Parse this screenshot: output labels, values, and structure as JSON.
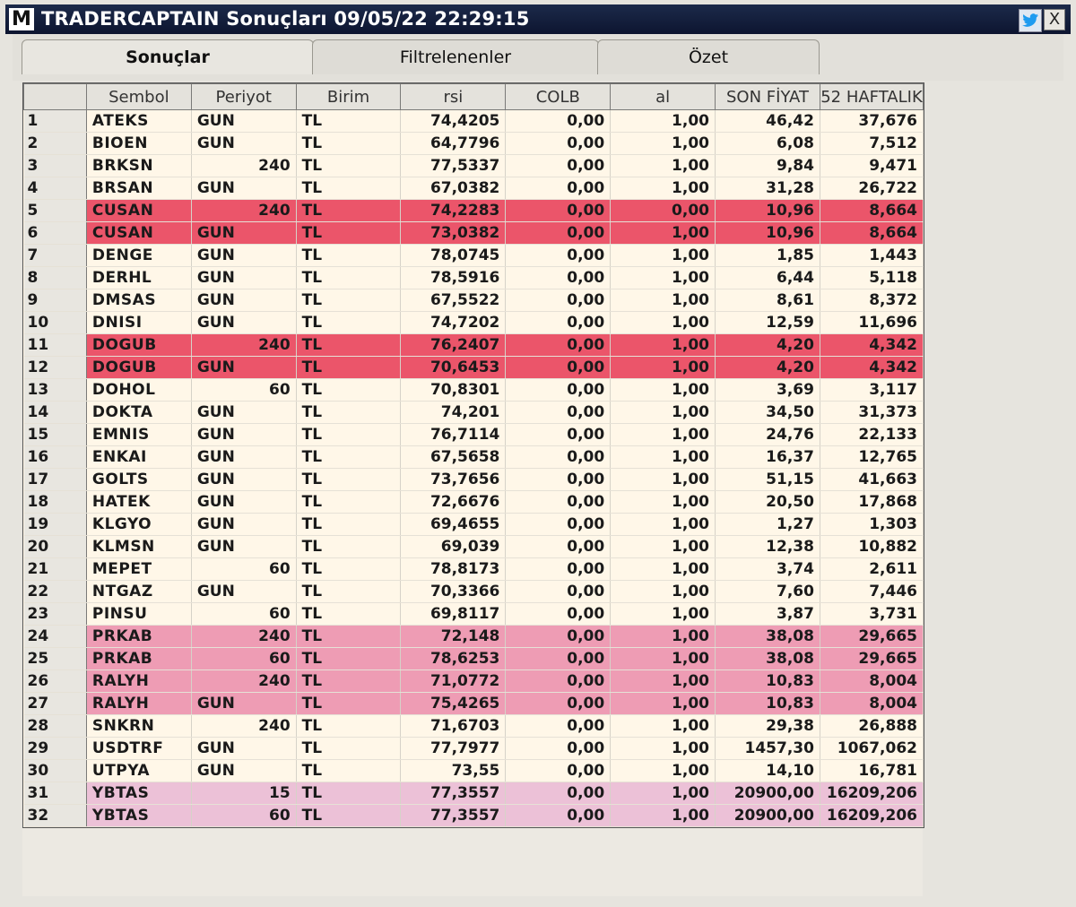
{
  "window": {
    "icon_letter": "M",
    "title": "TRADERCAPTAIN Sonuçları  09/05/22 22:29:15",
    "close_label": "X"
  },
  "tabs": [
    "Sonuçlar",
    "Filtrelenenler",
    "Özet"
  ],
  "columns": [
    "Sembol",
    "Periyot",
    "Birim",
    "rsi",
    "COLB",
    "al",
    "SON FİYAT",
    "52 HAFTALIK"
  ],
  "rows": [
    {
      "no": "1",
      "sym": "ATEKS",
      "per": "GUN",
      "unit": "TL",
      "rsi": "74,4205",
      "colb": "0,00",
      "al": "1,00",
      "price": "46,42",
      "w52": "37,676",
      "hl": ""
    },
    {
      "no": "2",
      "sym": "BIOEN",
      "per": "GUN",
      "unit": "TL",
      "rsi": "64,7796",
      "colb": "0,00",
      "al": "1,00",
      "price": "6,08",
      "w52": "7,512",
      "hl": ""
    },
    {
      "no": "3",
      "sym": "BRKSN",
      "per": "240",
      "unit": "TL",
      "rsi": "77,5337",
      "colb": "0,00",
      "al": "1,00",
      "price": "9,84",
      "w52": "9,471",
      "hl": ""
    },
    {
      "no": "4",
      "sym": "BRSAN",
      "per": "GUN",
      "unit": "TL",
      "rsi": "67,0382",
      "colb": "0,00",
      "al": "1,00",
      "price": "31,28",
      "w52": "26,722",
      "hl": ""
    },
    {
      "no": "5",
      "sym": "CUSAN",
      "per": "240",
      "unit": "TL",
      "rsi": "74,2283",
      "colb": "0,00",
      "al": "0,00",
      "price": "10,96",
      "w52": "8,664",
      "hl": "hl"
    },
    {
      "no": "6",
      "sym": "CUSAN",
      "per": "GUN",
      "unit": "TL",
      "rsi": "73,0382",
      "colb": "0,00",
      "al": "1,00",
      "price": "10,96",
      "w52": "8,664",
      "hl": "hl"
    },
    {
      "no": "7",
      "sym": "DENGE",
      "per": "GUN",
      "unit": "TL",
      "rsi": "78,0745",
      "colb": "0,00",
      "al": "1,00",
      "price": "1,85",
      "w52": "1,443",
      "hl": ""
    },
    {
      "no": "8",
      "sym": "DERHL",
      "per": "GUN",
      "unit": "TL",
      "rsi": "78,5916",
      "colb": "0,00",
      "al": "1,00",
      "price": "6,44",
      "w52": "5,118",
      "hl": ""
    },
    {
      "no": "9",
      "sym": "DMSAS",
      "per": "GUN",
      "unit": "TL",
      "rsi": "67,5522",
      "colb": "0,00",
      "al": "1,00",
      "price": "8,61",
      "w52": "8,372",
      "hl": ""
    },
    {
      "no": "10",
      "sym": "DNISI",
      "per": "GUN",
      "unit": "TL",
      "rsi": "74,7202",
      "colb": "0,00",
      "al": "1,00",
      "price": "12,59",
      "w52": "11,696",
      "hl": ""
    },
    {
      "no": "11",
      "sym": "DOGUB",
      "per": "240",
      "unit": "TL",
      "rsi": "76,2407",
      "colb": "0,00",
      "al": "1,00",
      "price": "4,20",
      "w52": "4,342",
      "hl": "hl"
    },
    {
      "no": "12",
      "sym": "DOGUB",
      "per": "GUN",
      "unit": "TL",
      "rsi": "70,6453",
      "colb": "0,00",
      "al": "1,00",
      "price": "4,20",
      "w52": "4,342",
      "hl": "hl"
    },
    {
      "no": "13",
      "sym": "DOHOL",
      "per": "60",
      "unit": "TL",
      "rsi": "70,8301",
      "colb": "0,00",
      "al": "1,00",
      "price": "3,69",
      "w52": "3,117",
      "hl": ""
    },
    {
      "no": "14",
      "sym": "DOKTA",
      "per": "GUN",
      "unit": "TL",
      "rsi": "74,201",
      "colb": "0,00",
      "al": "1,00",
      "price": "34,50",
      "w52": "31,373",
      "hl": ""
    },
    {
      "no": "15",
      "sym": "EMNIS",
      "per": "GUN",
      "unit": "TL",
      "rsi": "76,7114",
      "colb": "0,00",
      "al": "1,00",
      "price": "24,76",
      "w52": "22,133",
      "hl": ""
    },
    {
      "no": "16",
      "sym": "ENKAI",
      "per": "GUN",
      "unit": "TL",
      "rsi": "67,5658",
      "colb": "0,00",
      "al": "1,00",
      "price": "16,37",
      "w52": "12,765",
      "hl": ""
    },
    {
      "no": "17",
      "sym": "GOLTS",
      "per": "GUN",
      "unit": "TL",
      "rsi": "73,7656",
      "colb": "0,00",
      "al": "1,00",
      "price": "51,15",
      "w52": "41,663",
      "hl": ""
    },
    {
      "no": "18",
      "sym": "HATEK",
      "per": "GUN",
      "unit": "TL",
      "rsi": "72,6676",
      "colb": "0,00",
      "al": "1,00",
      "price": "20,50",
      "w52": "17,868",
      "hl": ""
    },
    {
      "no": "19",
      "sym": "KLGYO",
      "per": "GUN",
      "unit": "TL",
      "rsi": "69,4655",
      "colb": "0,00",
      "al": "1,00",
      "price": "1,27",
      "w52": "1,303",
      "hl": ""
    },
    {
      "no": "20",
      "sym": "KLMSN",
      "per": "GUN",
      "unit": "TL",
      "rsi": "69,039",
      "colb": "0,00",
      "al": "1,00",
      "price": "12,38",
      "w52": "10,882",
      "hl": ""
    },
    {
      "no": "21",
      "sym": "MEPET",
      "per": "60",
      "unit": "TL",
      "rsi": "78,8173",
      "colb": "0,00",
      "al": "1,00",
      "price": "3,74",
      "w52": "2,611",
      "hl": ""
    },
    {
      "no": "22",
      "sym": "NTGAZ",
      "per": "GUN",
      "unit": "TL",
      "rsi": "70,3366",
      "colb": "0,00",
      "al": "1,00",
      "price": "7,60",
      "w52": "7,446",
      "hl": ""
    },
    {
      "no": "23",
      "sym": "PINSU",
      "per": "60",
      "unit": "TL",
      "rsi": "69,8117",
      "colb": "0,00",
      "al": "1,00",
      "price": "3,87",
      "w52": "3,731",
      "hl": ""
    },
    {
      "no": "24",
      "sym": "PRKAB",
      "per": "240",
      "unit": "TL",
      "rsi": "72,148",
      "colb": "0,00",
      "al": "1,00",
      "price": "38,08",
      "w52": "29,665",
      "hl": "hl2"
    },
    {
      "no": "25",
      "sym": "PRKAB",
      "per": "60",
      "unit": "TL",
      "rsi": "78,6253",
      "colb": "0,00",
      "al": "1,00",
      "price": "38,08",
      "w52": "29,665",
      "hl": "hl2"
    },
    {
      "no": "26",
      "sym": "RALYH",
      "per": "240",
      "unit": "TL",
      "rsi": "71,0772",
      "colb": "0,00",
      "al": "1,00",
      "price": "10,83",
      "w52": "8,004",
      "hl": "hl2"
    },
    {
      "no": "27",
      "sym": "RALYH",
      "per": "GUN",
      "unit": "TL",
      "rsi": "75,4265",
      "colb": "0,00",
      "al": "1,00",
      "price": "10,83",
      "w52": "8,004",
      "hl": "hl2"
    },
    {
      "no": "28",
      "sym": "SNKRN",
      "per": "240",
      "unit": "TL",
      "rsi": "71,6703",
      "colb": "0,00",
      "al": "1,00",
      "price": "29,38",
      "w52": "26,888",
      "hl": ""
    },
    {
      "no": "29",
      "sym": "USDTRF",
      "per": "GUN",
      "unit": "TL",
      "rsi": "77,7977",
      "colb": "0,00",
      "al": "1,00",
      "price": "1457,30",
      "w52": "1067,062",
      "hl": ""
    },
    {
      "no": "30",
      "sym": "UTPYA",
      "per": "GUN",
      "unit": "TL",
      "rsi": "73,55",
      "colb": "0,00",
      "al": "1,00",
      "price": "14,10",
      "w52": "16,781",
      "hl": ""
    },
    {
      "no": "31",
      "sym": "YBTAS",
      "per": "15",
      "unit": "TL",
      "rsi": "77,3557",
      "colb": "0,00",
      "al": "1,00",
      "price": "20900,00",
      "w52": "16209,206",
      "hl": "hl3"
    },
    {
      "no": "32",
      "sym": "YBTAS",
      "per": "60",
      "unit": "TL",
      "rsi": "77,3557",
      "colb": "0,00",
      "al": "1,00",
      "price": "20900,00",
      "w52": "16209,206",
      "hl": "hl3"
    }
  ]
}
